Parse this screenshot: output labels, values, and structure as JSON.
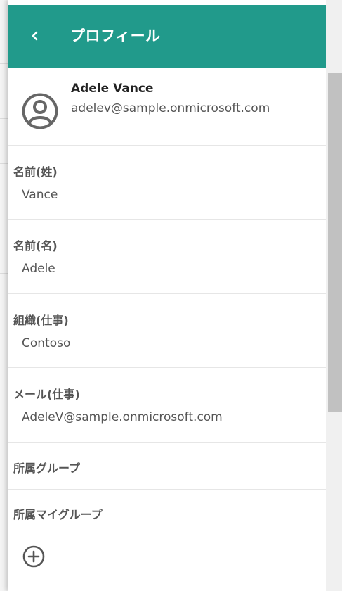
{
  "header": {
    "title": "プロフィール",
    "back_icon": "chevron-left-icon",
    "background": "#219a8b"
  },
  "user": {
    "name": "Adele Vance",
    "email": "adelev@sample.onmicrosoft.com",
    "avatar_icon": "user-circle-icon"
  },
  "fields": [
    {
      "label": "名前(姓)",
      "value": "Vance"
    },
    {
      "label": "名前(名)",
      "value": "Adele"
    },
    {
      "label": "組織(仕事)",
      "value": "Contoso"
    },
    {
      "label": "メール(仕事)",
      "value": "AdeleV@sample.onmicrosoft.com"
    }
  ],
  "sections": {
    "groups": "所属グループ",
    "my_groups": "所属マイグループ"
  },
  "add_icon": "plus-circle-icon"
}
